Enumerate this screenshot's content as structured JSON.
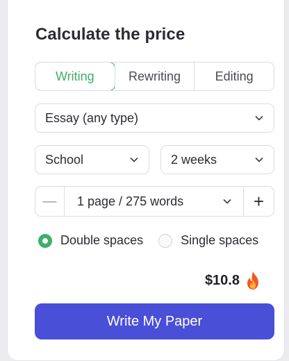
{
  "calculator": {
    "title": "Calculate the price",
    "tabs": [
      {
        "label": "Writing",
        "active": true
      },
      {
        "label": "Rewriting",
        "active": false
      },
      {
        "label": "Editing",
        "active": false
      }
    ],
    "paper_type": "Essay (any type)",
    "academic_level": "School",
    "deadline": "2 weeks",
    "pages": {
      "minus_symbol": "—",
      "value": "1 page / 275 words",
      "plus_symbol": "+"
    },
    "spacing": [
      {
        "label": "Double spaces",
        "selected": true
      },
      {
        "label": "Single spaces",
        "selected": false
      }
    ],
    "price": "$10.8",
    "cta_label": "Write My Paper"
  },
  "colors": {
    "accent_green": "#3fae6a",
    "button_blue": "#4a4fd8",
    "border": "#dcdce2"
  },
  "icons": [
    "chevron-down-icon",
    "minus-icon",
    "plus-icon",
    "flame-icon",
    "radio-icon"
  ]
}
